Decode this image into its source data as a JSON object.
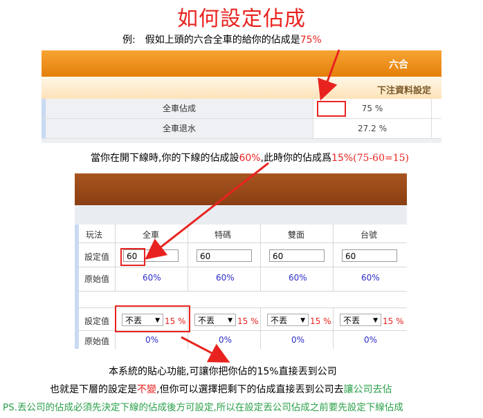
{
  "title": "如何設定佔成",
  "example_line": {
    "prefix": "例:　假如上頭的六合全車的給你的佔成是",
    "value": "75%"
  },
  "panel1": {
    "header": "六合",
    "subheader": "下注資料設定",
    "rows": [
      {
        "label": "全車佔成",
        "value": "75 %"
      },
      {
        "label": "全車退水",
        "value": "27.2 %"
      }
    ]
  },
  "middle_line": {
    "part1": "當你在開下線時,你的下線的佔成設",
    "v1": "60%",
    "part2": ",此時你的佔成爲",
    "v2": "15%",
    "calc": "(75-60=15)"
  },
  "panel2": {
    "columns": [
      "玩法",
      "全車",
      "特碼",
      "雙面",
      "台號"
    ],
    "row_set_label": "設定值",
    "row_orig_label": "原始值",
    "set_values": [
      "60",
      "60",
      "60",
      "60"
    ],
    "orig_values": [
      "60%",
      "60%",
      "60%",
      "60%"
    ],
    "drop_label": "設定值",
    "drop_values": [
      "不丟",
      "不丟",
      "不丟",
      "不丟"
    ],
    "drop_pcts": [
      "15 %",
      "15 %",
      "15 %",
      "15 %"
    ],
    "orig2_label": "原始值",
    "orig2_values": [
      "0%",
      "0%",
      "0%",
      "0%"
    ]
  },
  "bottom": {
    "line1": "本系統的貼心功能,可讓你把你佔的15%直接丟到公司",
    "line2_a": "也就是下層的設定是",
    "line2_b": "不變",
    "line2_c": ",但你可以選擇把剩下的佔成直接丟到公司去",
    "line2_d": "讓公司去佔",
    "line3": "PS.丟公司的佔成必須先決定下線的佔成後方可設定,所以在設定丟公司佔成之前要先設定下線佔成"
  },
  "colors": {
    "accent_red": "#e8231f",
    "green": "#2aa04a",
    "orange": "#f08a10",
    "brown": "#9c4b1a",
    "blue": "#2c2cc8"
  }
}
